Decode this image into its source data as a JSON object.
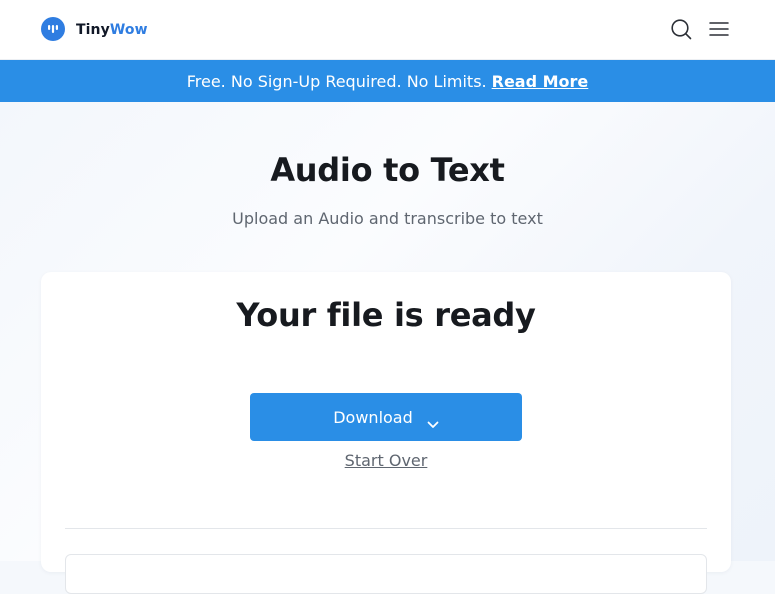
{
  "header": {
    "brand_part1": "Tiny",
    "brand_part2": "Wow",
    "brand_color": "#2f7de1",
    "icons": [
      "search-icon",
      "menu-icon"
    ]
  },
  "banner": {
    "text": "Free. No Sign-Up Required. No Limits.",
    "link": "Read More",
    "color": "#2a8ee6"
  },
  "hero": {
    "title": "Audio to Text",
    "subtitle": "Upload an Audio and transcribe to text"
  },
  "card": {
    "title": "Your file is ready",
    "download_label": "Download",
    "start_over_label": "Start Over"
  }
}
